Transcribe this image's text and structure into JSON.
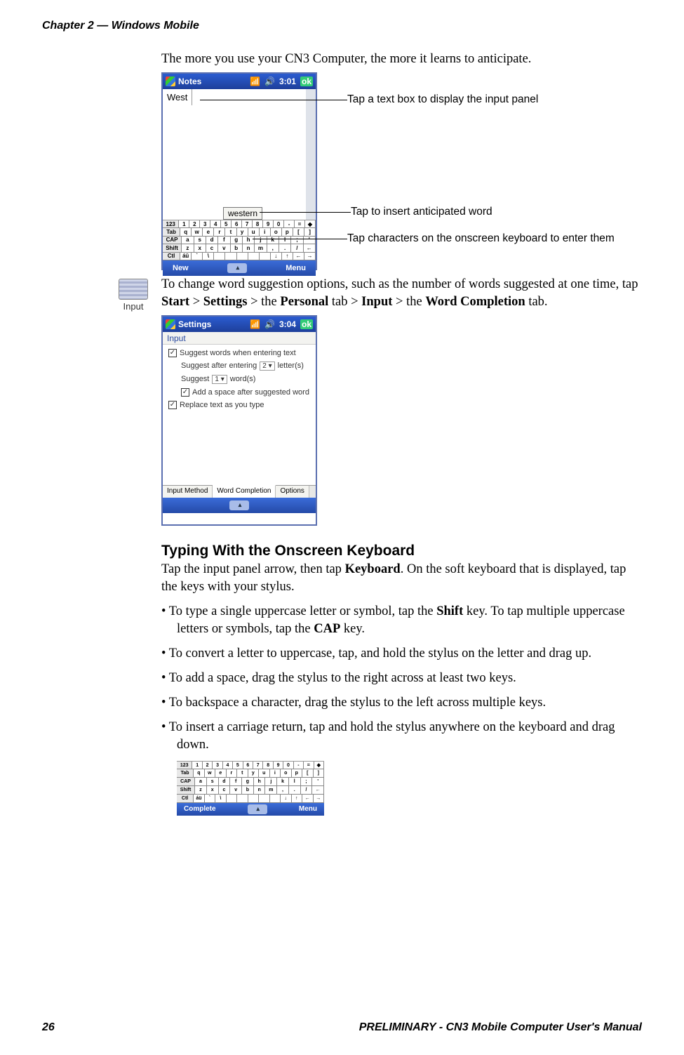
{
  "header": {
    "chapter": "Chapter 2 — Windows Mobile"
  },
  "intro": "The more you use your CN3 Computer, the more it learns to anticipate.",
  "fig1": {
    "title": "Notes",
    "time": "3:01",
    "ok": "ok",
    "word": "West",
    "suggestion": "western",
    "softkey_left": "New",
    "softkey_right": "Menu",
    "annot_textbox": "Tap a text box to display the input panel",
    "annot_suggest": "Tap to insert anticipated word",
    "annot_kb": "Tap characters on the onscreen keyboard to enter them"
  },
  "icon_label": "Input",
  "para2_a": "To change word suggestion options, such as the number of words suggested at one time, tap ",
  "para2_b": " > ",
  "para2_c": " > the ",
  "para2_d": " tab > ",
  "para2_e": " > the ",
  "para2_f": " tab.",
  "bold": {
    "start": "Start",
    "settings": "Settings",
    "personal": "Personal",
    "input": "Input",
    "wordcomp": "Word Completion"
  },
  "fig2": {
    "title": "Settings",
    "time": "3:04",
    "ok": "ok",
    "heading": "Input",
    "opt1": "Suggest words when entering text",
    "opt2a": "Suggest after entering",
    "opt2_dd": "2",
    "opt2b": "letter(s)",
    "opt3a": "Suggest",
    "opt3_dd": "1",
    "opt3b": "word(s)",
    "opt4": "Add a space after suggested word",
    "opt5": "Replace text as you type",
    "tab1": "Input Method",
    "tab2": "Word Completion",
    "tab3": "Options"
  },
  "h3": "Typing With the Onscreen Keyboard",
  "para3_a": "Tap the input panel arrow, then tap ",
  "para3_kb": "Keyboard",
  "para3_b": ". On the soft keyboard that is displayed, tap the keys with your stylus.",
  "bullets": {
    "b1_a": "To type a single uppercase letter or symbol, tap the ",
    "b1_shift": "Shift",
    "b1_b": " key. To tap multiple uppercase letters or symbols, tap the ",
    "b1_cap": "CAP",
    "b1_c": " key.",
    "b2": "To convert a letter to uppercase, tap, and hold the stylus on the letter and drag up.",
    "b3": "To add a space, drag the stylus to the right across at least two keys.",
    "b4": "To backspace a character, drag the stylus to the left across multiple keys.",
    "b5": "To insert a carriage return, tap and hold the stylus anywhere on the keyboard and drag down."
  },
  "fig3": {
    "softkey_left": "Complete",
    "softkey_right": "Menu"
  },
  "kb": {
    "r1": [
      "123",
      "1",
      "2",
      "3",
      "4",
      "5",
      "6",
      "7",
      "8",
      "9",
      "0",
      "-",
      "=",
      "◆"
    ],
    "r2": [
      "Tab",
      "q",
      "w",
      "e",
      "r",
      "t",
      "y",
      "u",
      "i",
      "o",
      "p",
      "[",
      "]"
    ],
    "r3": [
      "CAP",
      "a",
      "s",
      "d",
      "f",
      "g",
      "h",
      "j",
      "k",
      "l",
      ";",
      "'"
    ],
    "r4": [
      "Shift",
      "z",
      "x",
      "c",
      "v",
      "b",
      "n",
      "m",
      ",",
      ".",
      "/",
      "←"
    ],
    "r5": [
      "Ctl",
      "áü",
      "`",
      "\\",
      "",
      "",
      "",
      "",
      "",
      "↓",
      "↑",
      "←",
      "→"
    ]
  },
  "footer": {
    "page": "26",
    "title": "PRELIMINARY - CN3 Mobile Computer User's Manual"
  }
}
